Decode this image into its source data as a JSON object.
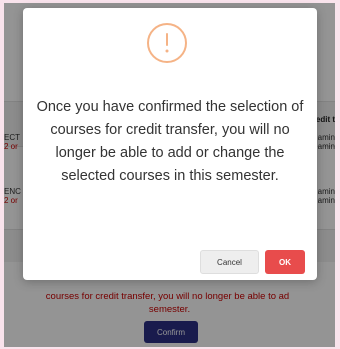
{
  "background": {
    "column_header": "edit t",
    "rows": [
      {
        "left_code": "ECT",
        "left_sub": "2 or",
        "right_a": "amin",
        "right_b": "amin"
      },
      {
        "left_code": "ENC",
        "left_sub": "2 or",
        "right_a": "amin",
        "right_b": "amin"
      }
    ],
    "warning_line1": "courses for credit transfer, you will no longer be able to ad",
    "warning_line2": "semester.",
    "confirm_label": "Confirm"
  },
  "modal": {
    "icon": "exclamation-icon",
    "icon_color": "#f5b386",
    "message": "Once you have confirmed the selection of courses for credit transfer, you will no longer be able to add or change the selected courses in this semester.",
    "cancel_label": "Cancel",
    "ok_label": "OK",
    "ok_color": "#e84c4c"
  }
}
